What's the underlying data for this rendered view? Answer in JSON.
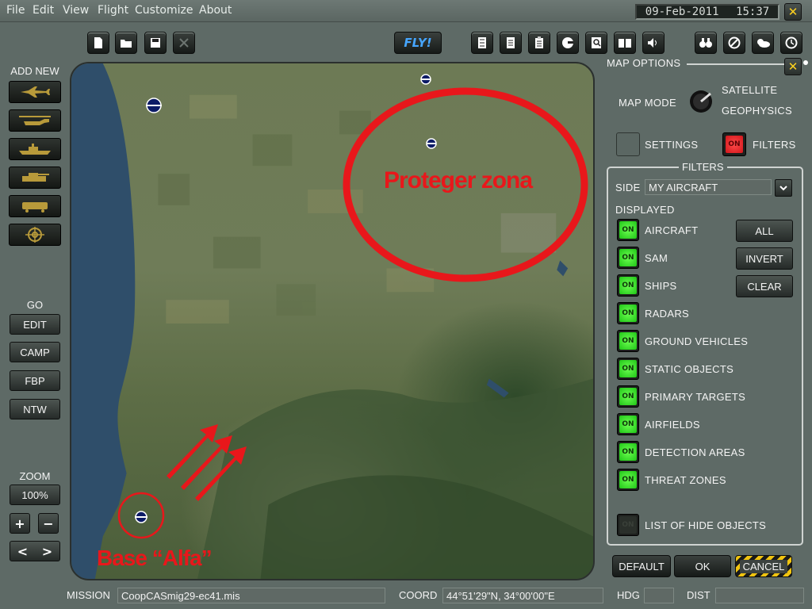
{
  "menu": {
    "items": [
      "File",
      "Edit",
      "View",
      "Flight",
      "Customize",
      "About"
    ],
    "date": "09-Feb-2011",
    "time": "15:37",
    "close_label": "✕"
  },
  "toolbar": {
    "fly_label": "FLY!",
    "left_icons": [
      "new-file-icon",
      "open-folder-icon",
      "save-icon",
      "delete-icon"
    ],
    "center_icons": [
      "calculator-icon",
      "briefing-icon",
      "clipboard-icon",
      "pilot-head-icon",
      "zoom-page-icon",
      "book-icon",
      "speaker-icon"
    ],
    "right_icons": [
      "binoculars-icon",
      "no-entry-icon",
      "weather-icon",
      "clock-icon"
    ]
  },
  "left_panel": {
    "add_new_label": "ADD NEW",
    "add_new_items": [
      "aircraft-icon",
      "helicopter-icon",
      "ship-icon",
      "vehicle-icon",
      "train-icon",
      "target-icon"
    ],
    "go_label": "GO",
    "go_buttons": [
      "EDIT",
      "CAMP",
      "FBP",
      "NTW"
    ],
    "zoom_label": "ZOOM",
    "zoom_value": "100%",
    "zoom_in": "+",
    "zoom_out": "−",
    "prev": "<",
    "next": ">"
  },
  "map": {
    "annotation_zone": "Proteger zona",
    "annotation_base": "Base “Alfa”"
  },
  "map_options": {
    "title": "MAP OPTIONS",
    "map_mode_label": "MAP MODE",
    "mode_satellite": "SATELLITE",
    "mode_geophysics": "GEOPHYSICS",
    "settings_label": "SETTINGS",
    "filters_toggle_label": "FILTERS",
    "filters_toggle_state": "ON",
    "filters_title": "FILTERS",
    "side_label": "SIDE",
    "side_value": "MY AIRCRAFT",
    "displayed_label": "DISPLAYED",
    "on_text": "ON",
    "filters": [
      {
        "label": "AIRCRAFT",
        "state": "ON"
      },
      {
        "label": "SAM",
        "state": "ON"
      },
      {
        "label": "SHIPS",
        "state": "ON"
      },
      {
        "label": "RADARS",
        "state": "ON"
      },
      {
        "label": "GROUND VEHICLES",
        "state": "ON"
      },
      {
        "label": "STATIC OBJECTS",
        "state": "ON"
      },
      {
        "label": "PRIMARY TARGETS",
        "state": "ON"
      },
      {
        "label": "AIRFIELDS",
        "state": "ON"
      },
      {
        "label": "DETECTION AREAS",
        "state": "ON"
      },
      {
        "label": "THREAT ZONES",
        "state": "ON"
      }
    ],
    "hide_objects": {
      "label": "LIST OF HIDE OBJECTS",
      "state": "ON"
    },
    "action_buttons": [
      "ALL",
      "INVERT",
      "CLEAR"
    ],
    "default_label": "DEFAULT",
    "ok_label": "OK",
    "cancel_label": "CANCEL"
  },
  "status": {
    "mission_label": "MISSION",
    "mission_value": "CoopCASmig29-ec41.mis",
    "coord_label": "COORD",
    "coord_value": "44°51'29\"N, 34°00'00\"E",
    "hdg_label": "HDG",
    "hdg_value": "",
    "dist_label": "DIST",
    "dist_value": ""
  },
  "colors": {
    "accent_green": "#3ef12a",
    "accent_red": "#e8171b",
    "fly_blue": "#46a6ff",
    "hazard_yellow": "#f1c40f"
  }
}
